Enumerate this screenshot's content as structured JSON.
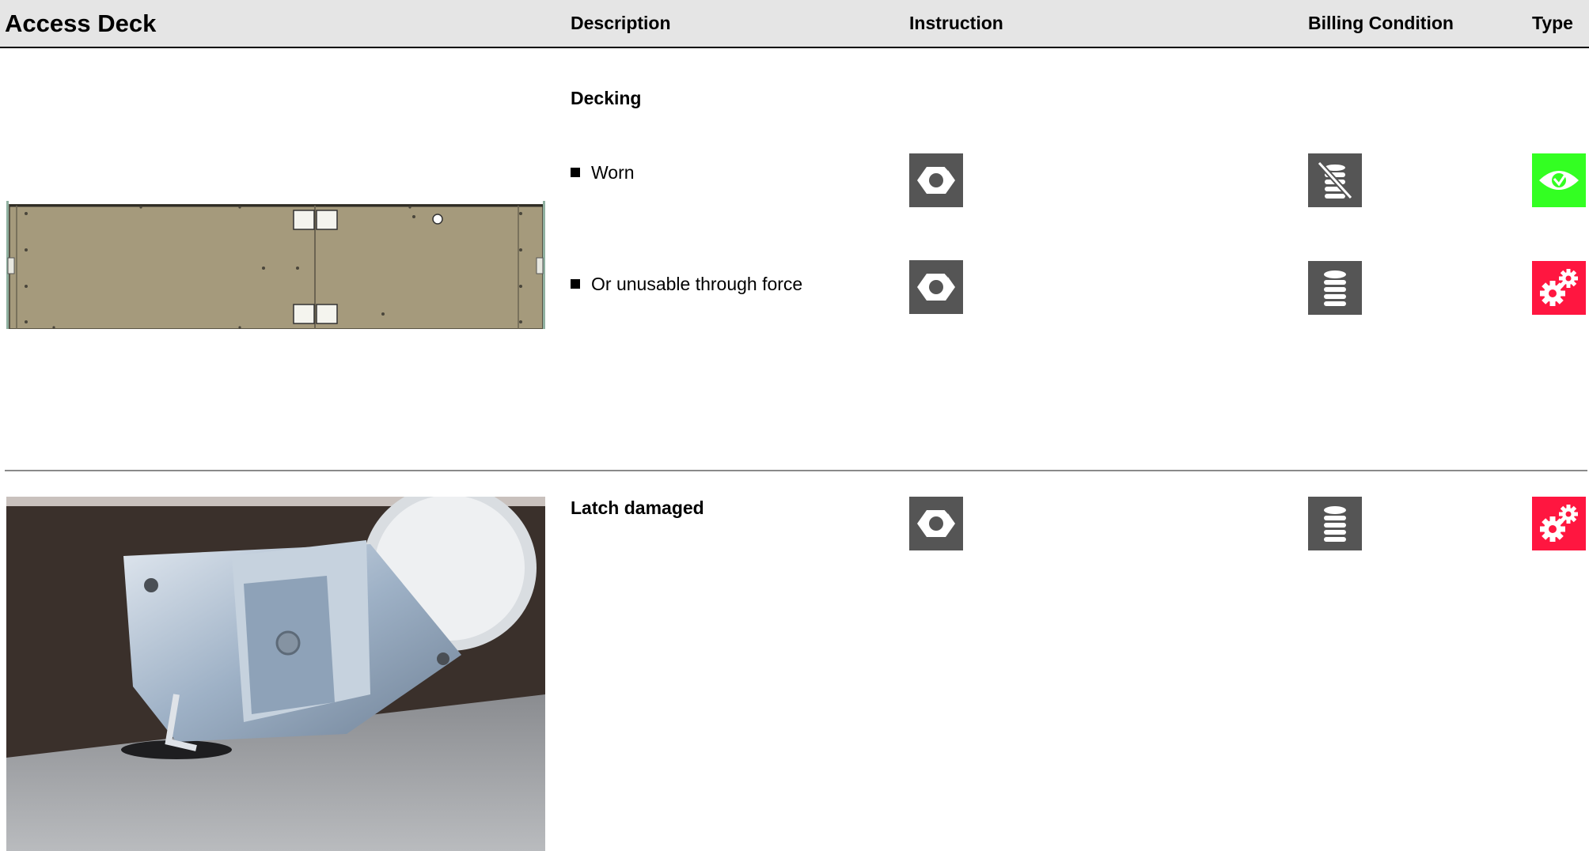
{
  "header": {
    "title": "Access Deck",
    "columns": {
      "description": "Description",
      "instruction": "Instruction",
      "billing": "Billing Condition",
      "type": "Type"
    }
  },
  "sections": [
    {
      "heading": "Decking",
      "image": "access-deck-panel-drawing",
      "items": [
        {
          "text": "Worn",
          "instruction_icon": "hex-nut-repair-icon",
          "billing_icon": "no-charge-coins-icon",
          "type_icon": "eye-inspection-icon",
          "type_color": "#33ff22"
        },
        {
          "text": "Or unusable through force",
          "instruction_icon": "hex-nut-repair-icon",
          "billing_icon": "coins-stack-icon",
          "type_icon": "gears-damage-icon",
          "type_color": "#ff1640"
        }
      ]
    },
    {
      "heading": "Latch damaged",
      "image": "latch-photo",
      "instruction_icon": "hex-nut-repair-icon",
      "billing_icon": "coins-stack-icon",
      "type_icon": "gears-damage-icon",
      "type_color": "#ff1640"
    }
  ],
  "colors": {
    "header_bg": "#e5e5e5",
    "icon_bg": "#555555",
    "green": "#33ff22",
    "red": "#ff1640"
  }
}
